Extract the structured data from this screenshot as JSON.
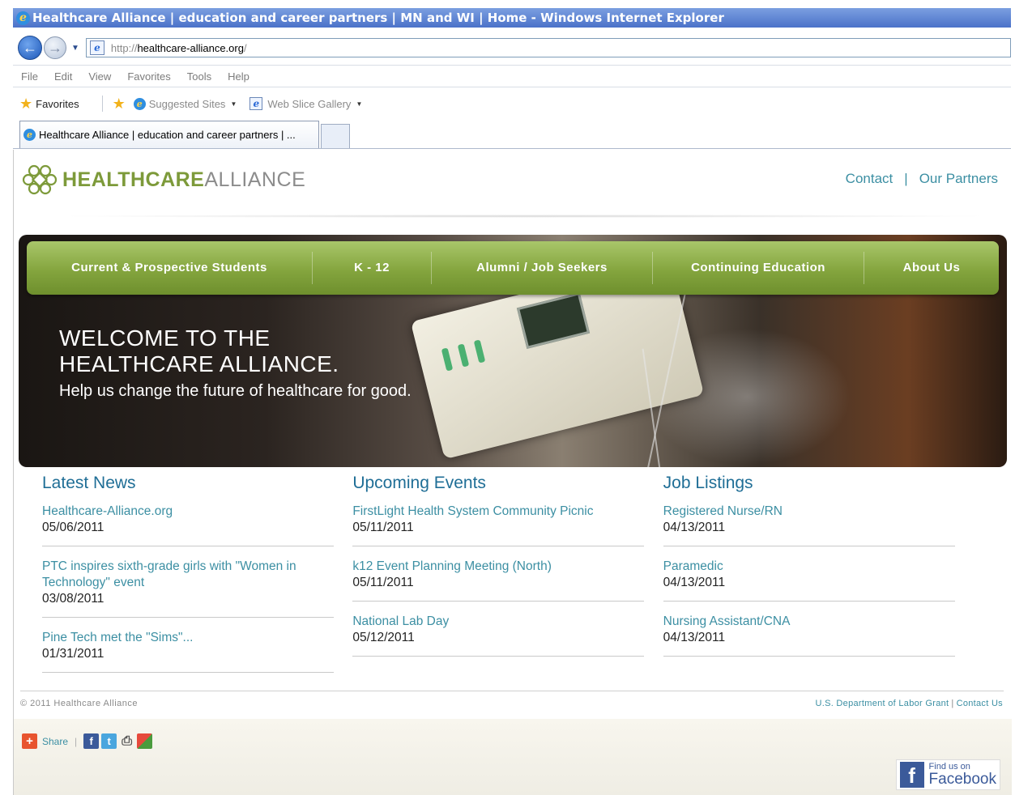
{
  "window": {
    "title": "Healthcare Alliance | education and career partners | MN and WI | Home - Windows Internet Explorer"
  },
  "address": {
    "url_protocol": "http://",
    "url_host": "healthcare-alliance.org",
    "url_tail": "/"
  },
  "menu": [
    "File",
    "Edit",
    "View",
    "Favorites",
    "Tools",
    "Help"
  ],
  "favorites_bar": {
    "favorites_label": "Favorites",
    "suggested_sites": "Suggested Sites",
    "web_slice_gallery": "Web Slice Gallery"
  },
  "tab": {
    "label": "Healthcare Alliance | education and career partners | ..."
  },
  "site": {
    "logo_bold": "HEALTHCARE",
    "logo_light": "ALLIANCE",
    "brand_color": "#7d9a3a",
    "link_color": "#3c8fa3",
    "heading_color": "#1f6e96",
    "top_links": [
      "Contact",
      "Our Partners"
    ],
    "nav": [
      "Current & Prospective Students",
      "K - 12",
      "Alumni / Job Seekers",
      "Continuing Education",
      "About Us"
    ],
    "hero": {
      "line1": "WELCOME TO THE",
      "line2": "HEALTHCARE ALLIANCE.",
      "subtitle": "Help us change the future of healthcare for good."
    },
    "columns": [
      {
        "title": "Latest News",
        "items": [
          {
            "title": "Healthcare-Alliance.org",
            "date": "05/06/2011"
          },
          {
            "title": "PTC inspires sixth-grade girls with \"Women in Technology\" event",
            "date": "03/08/2011"
          },
          {
            "title": "Pine Tech met the \"Sims\"...",
            "date": "01/31/2011"
          }
        ]
      },
      {
        "title": "Upcoming Events",
        "items": [
          {
            "title": "FirstLight Health System Community Picnic",
            "date": "05/11/2011"
          },
          {
            "title": "k12 Event Planning Meeting (North)",
            "date": "05/11/2011"
          },
          {
            "title": "National Lab Day",
            "date": "05/12/2011"
          }
        ]
      },
      {
        "title": "Job Listings",
        "items": [
          {
            "title": "Registered Nurse/RN",
            "date": "04/13/2011"
          },
          {
            "title": "Paramedic",
            "date": "04/13/2011"
          },
          {
            "title": "Nursing Assistant/CNA",
            "date": "04/13/2011"
          }
        ]
      }
    ],
    "footer": {
      "copyright": "© 2011 Healthcare Alliance",
      "grant_link": "U.S. Department of Labor Grant",
      "contact_link": "Contact Us",
      "share_label": "Share",
      "fb_small": "Find us on",
      "fb_big": "Facebook"
    }
  }
}
